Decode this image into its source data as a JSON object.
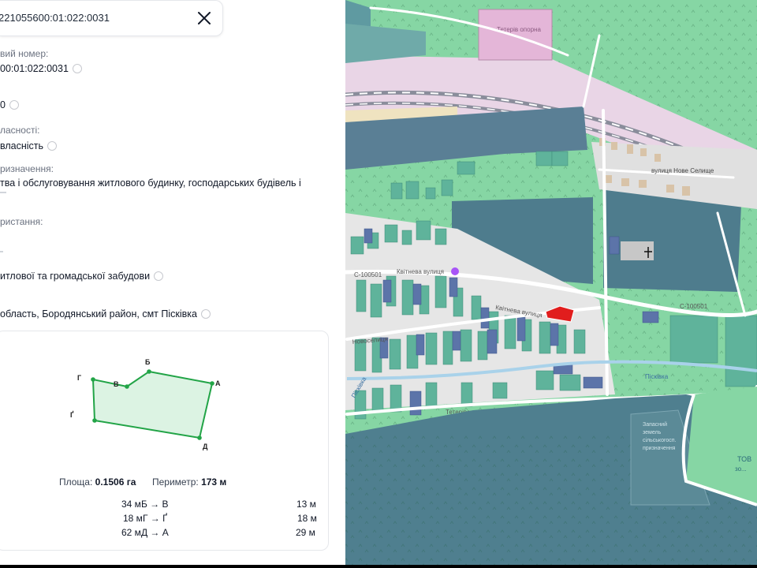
{
  "panel": {
    "cadastral_number": "221055600:01:022:0031",
    "close_label": "✕",
    "fields": [
      {
        "label": "вий номер:",
        "value": "00:01:022:0031"
      },
      {
        "label": "",
        "value": "0"
      },
      {
        "label": "ласності:",
        "value": "власність"
      },
      {
        "label": "ризначення:",
        "value": "тва і обслуговування житлового будинку, господарських будівель і"
      },
      {
        "label": "ристання:",
        "value": ""
      },
      {
        "label": "",
        "value": "итлової та громадської забудови"
      },
      {
        "label": "",
        "value": "область, Бородянський район, смт Пісківка"
      }
    ]
  },
  "plot": {
    "vertices": [
      "Б",
      "А",
      "Д",
      "Ґ",
      "Г",
      "В"
    ],
    "area_label": "Площа:",
    "area_value": "0.1506 га",
    "perimeter_label": "Периметр:",
    "perimeter_value": "173 м",
    "sides": [
      {
        "azimuth": "34 м",
        "segment": "Б → В",
        "length": "13 м"
      },
      {
        "azimuth": "18 м",
        "segment": "Г → Ґ",
        "length": "18 м"
      },
      {
        "azimuth": "62 м",
        "segment": "Д → А",
        "length": "29 м"
      }
    ]
  },
  "map": {
    "labels": {
      "station": "Тетерів опорна",
      "street_nove_selyshche": "вулиця Нове Селище",
      "road_west": "С-100501",
      "road_east": "С-100501",
      "kvitneva_1": "Квітнева вулиця",
      "kvitneva_2": "Квітнева вулиця",
      "novoselytsia": "Новоселиця",
      "teterivska": "Тетерівська вулиця",
      "river": "Пісківка",
      "river_west": "Пісківка",
      "forest_note_1": "Запасний",
      "forest_note_2": "земель",
      "forest_note_3": "сільськогосп.",
      "forest_note_4": "призначення",
      "tov": "ТОВ",
      "tov2": "зо..."
    },
    "colors": {
      "highlight": "#e11d1d",
      "forest": "#4f7f8f",
      "green": "#7fd3a0",
      "railway": "#8a8d9b"
    }
  }
}
